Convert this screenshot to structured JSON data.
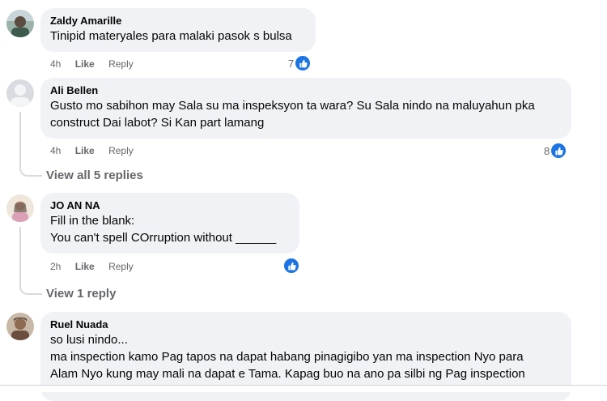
{
  "comments": [
    {
      "name": "Zaldy Amarille",
      "lines": [
        "Tinipid materyales para malaki pasok s bulsa"
      ],
      "time": "4h",
      "like": "Like",
      "reply": "Reply",
      "reactions": "7"
    },
    {
      "name": "Ali Bellen",
      "lines": [
        "Gusto mo sabihon may Sala su ma inspeksyon ta wara? Su Sala nindo na maluyahun pka",
        "construct Dai labot? Si Kan part lamang"
      ],
      "time": "4h",
      "like": "Like",
      "reply": "Reply",
      "reactions": "8",
      "view_replies": "View all 5 replies"
    },
    {
      "name": "JO AN NA",
      "lines": [
        "Fill in the blank:",
        "You can't spell COrruption without ______"
      ],
      "time": "2h",
      "like": "Like",
      "reply": "Reply",
      "reactions": "",
      "view_replies": "View 1 reply"
    },
    {
      "name": "Ruel Nuada",
      "lines": [
        "so lusi nindo...",
        "ma inspection kamo Pag tapos na dapat habang pinagigibo yan ma inspection Nyo para",
        "Alam Nyo kung may mali na dapat e Tama. Kapag buo na ano pa silbi ng Pag inspection"
      ]
    }
  ],
  "colors": {
    "accent": "#1b74e4",
    "bubble": "#f0f2f5",
    "muted": "#65676b"
  },
  "icons": {
    "reaction": "thumbs-up-icon"
  }
}
